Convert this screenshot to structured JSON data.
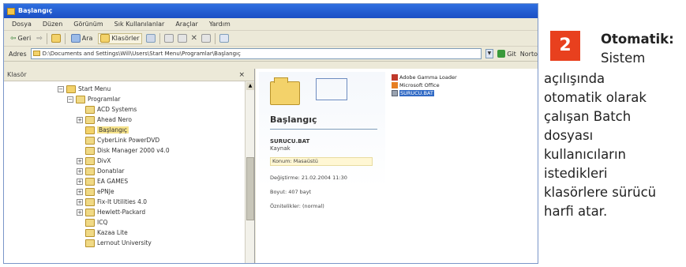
{
  "window": {
    "title": "Başlangıç",
    "menu": [
      "Dosya",
      "Düzen",
      "Görünüm",
      "Sık Kullanılanlar",
      "Araçlar",
      "Yardım"
    ],
    "toolbar": {
      "back": "Geri",
      "search": "Ara",
      "folders": "Klasörler"
    },
    "address": {
      "label": "Adres",
      "value": "D:\\Documents and Settings\\Will\\Users\\Start Menu\\Programlar\\Başlangıç",
      "go_label": "Git",
      "links_label": "Norto"
    },
    "folders_pane": {
      "title": "Klasör",
      "close": "×",
      "items": [
        {
          "label": "Start Menu",
          "expander": "−"
        },
        {
          "label": "Programlar",
          "expander": "−"
        },
        {
          "label": "ACD Systems",
          "expander": ""
        },
        {
          "label": "Ahead Nero",
          "expander": "+"
        },
        {
          "label": "Başlangıç",
          "expander": ""
        },
        {
          "label": "CyberLink PowerDVD",
          "expander": ""
        },
        {
          "label": "Disk Manager 2000 v4.0",
          "expander": ""
        },
        {
          "label": "DivX",
          "expander": "+"
        },
        {
          "label": "Donatılar",
          "expander": "+"
        },
        {
          "label": "EA GAMES",
          "expander": "+"
        },
        {
          "label": "ePNJe",
          "expander": "+"
        },
        {
          "label": "Fix-It Utilities 4.0",
          "expander": "+"
        },
        {
          "label": "Hewlett-Packard",
          "expander": "+"
        },
        {
          "label": "ICQ",
          "expander": ""
        },
        {
          "label": "Kazaa Lite",
          "expander": ""
        },
        {
          "label": "Lernout University",
          "expander": ""
        }
      ]
    },
    "content": {
      "heading": "Başlangıç",
      "selected_name": "SURUCU.BAT",
      "selected_type": "Kaynak",
      "location": "Konum: Masaüstü",
      "modified": "Değiştirme: 21.02.2004 11:30",
      "size": "Boyut: 407 bayt",
      "attributes": "Öznitelikler: (normal)",
      "files": [
        {
          "name": "Adobe Gamma Loader",
          "selected": false
        },
        {
          "name": "Microsoft Office",
          "selected": false
        },
        {
          "name": "SURUCU.BAT",
          "selected": true
        }
      ]
    }
  },
  "annotation": {
    "number": "2",
    "title": "Otomatik:",
    "lines": [
      "Sistem",
      "açılışında",
      "otomatik olarak",
      "çalışan Batch",
      "dosyası",
      "kullanıcıların",
      "istedikleri",
      "klasörlere sürücü",
      "harfi atar."
    ]
  },
  "colors": {
    "badge": "#e8401e",
    "titlebar": "#1b4fc4",
    "selection": "#316ac5"
  }
}
